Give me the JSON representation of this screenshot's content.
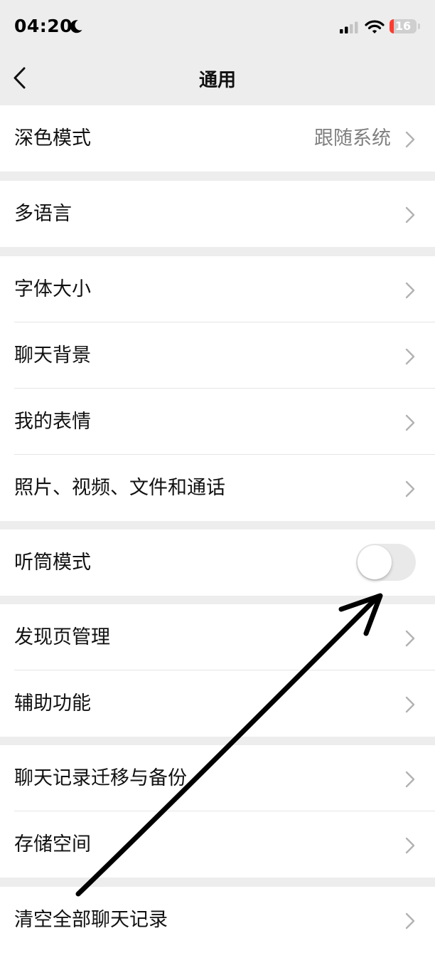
{
  "status_bar": {
    "time": "04:20",
    "battery": "16",
    "battery_level": 0.16,
    "icons": [
      "moon-icon",
      "cellular-signal-icon",
      "wifi-icon",
      "battery-icon"
    ]
  },
  "nav": {
    "title": "通用",
    "back_icon": "chevron-left-icon"
  },
  "groups": [
    {
      "items": [
        {
          "label": "深色模式",
          "value": "跟随系统"
        }
      ]
    },
    {
      "items": [
        {
          "label": "多语言"
        }
      ]
    },
    {
      "items": [
        {
          "label": "字体大小"
        },
        {
          "label": "聊天背景"
        },
        {
          "label": "我的表情"
        },
        {
          "label": "照片、视频、文件和通话"
        }
      ]
    },
    {
      "items": [
        {
          "label": "听筒模式",
          "toggle": false
        }
      ]
    },
    {
      "items": [
        {
          "label": "发现页管理"
        },
        {
          "label": "辅助功能"
        }
      ]
    },
    {
      "items": [
        {
          "label": "聊天记录迁移与备份"
        },
        {
          "label": "存储空间"
        }
      ]
    },
    {
      "items": [
        {
          "label": "清空全部聊天记录"
        }
      ]
    }
  ],
  "colors": {
    "background": "#ededed",
    "row_background": "#ffffff",
    "value_text": "#808080",
    "chevron": "#b2b2b2",
    "toggle_off": "#e9e9ea",
    "battery_low": "#ff3b30"
  },
  "annotation": {
    "type": "hand-drawn-arrow",
    "color": "#000000"
  }
}
